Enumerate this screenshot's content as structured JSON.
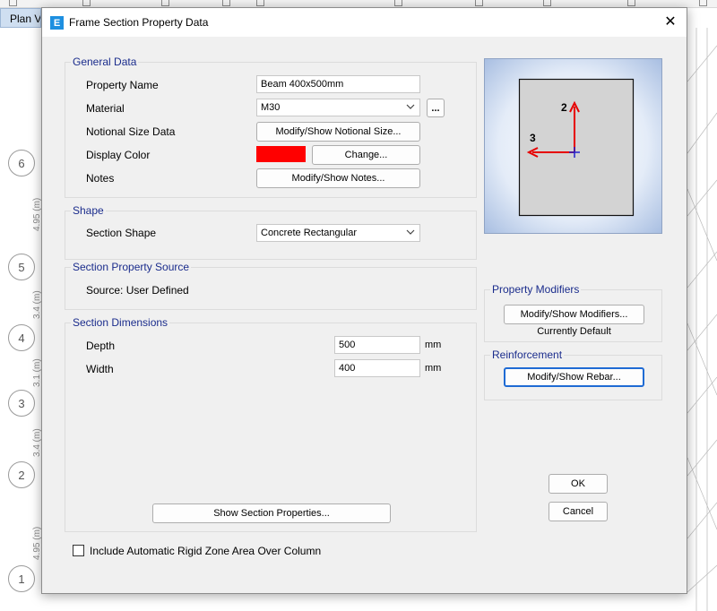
{
  "background": {
    "tab_label": "Plan Vi",
    "grid_bubbles": [
      "6",
      "5",
      "4",
      "3",
      "2",
      "1"
    ],
    "grid_dims": [
      "4.95 (m)",
      "3.4 (m)",
      "3.1 (m)",
      "3.4 (m)",
      "4.95 (m)"
    ]
  },
  "dialog": {
    "title": "Frame Section Property Data",
    "close_glyph": "✕",
    "general_data": {
      "title": "General Data",
      "property_name_label": "Property Name",
      "property_name_value": "Beam 400x500mm",
      "material_label": "Material",
      "material_value": "M30",
      "material_more_button": "...",
      "notional_size_label": "Notional Size Data",
      "notional_size_button": "Modify/Show Notional Size...",
      "display_color_label": "Display Color",
      "display_color_value": "#ff0000",
      "change_button": "Change...",
      "notes_label": "Notes",
      "notes_button": "Modify/Show Notes..."
    },
    "shape": {
      "title": "Shape",
      "section_shape_label": "Section Shape",
      "section_shape_value": "Concrete Rectangular"
    },
    "section_property_source": {
      "title": "Section Property Source",
      "source_text": "Source:  User Defined"
    },
    "section_dimensions": {
      "title": "Section Dimensions",
      "depth_label": "Depth",
      "depth_value": "500",
      "depth_unit": "mm",
      "width_label": "Width",
      "width_value": "400",
      "width_unit": "mm",
      "show_properties_button": "Show Section Properties..."
    },
    "preview": {
      "axis2_label": "2",
      "axis3_label": "3"
    },
    "property_modifiers": {
      "title": "Property Modifiers",
      "button": "Modify/Show Modifiers...",
      "status": "Currently Default"
    },
    "reinforcement": {
      "title": "Reinforcement",
      "button": "Modify/Show Rebar..."
    },
    "rigid_zone_checkbox_label": "Include Automatic Rigid Zone Area Over Column",
    "rigid_zone_checked": false,
    "ok_button": "OK",
    "cancel_button": "Cancel"
  }
}
